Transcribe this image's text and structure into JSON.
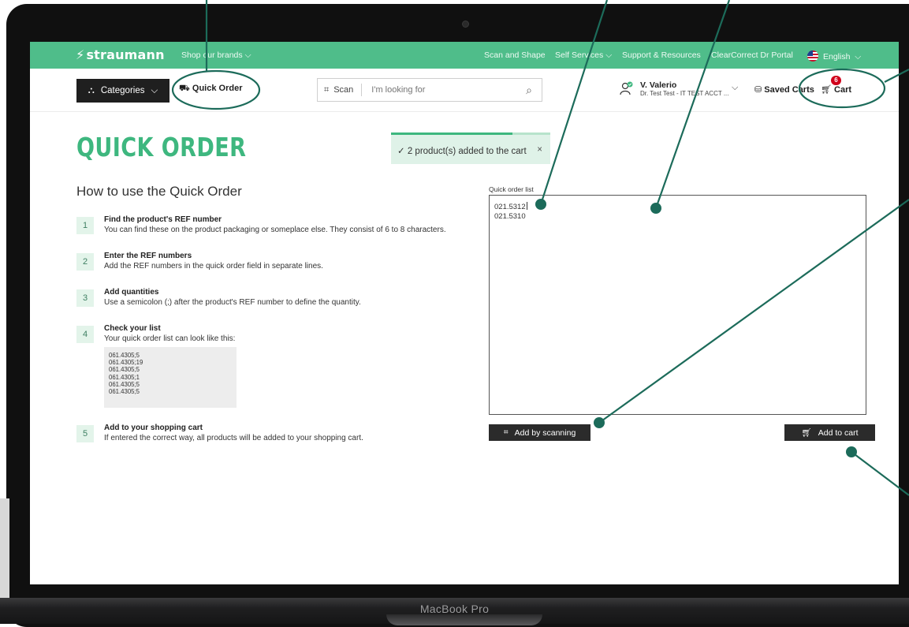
{
  "device": {
    "label": "MacBook Pro"
  },
  "topbar": {
    "brand": "straumann",
    "shop_brands": "Shop our brands",
    "scan_shape": "Scan and Shape",
    "self_services": "Self Services",
    "support": "Support & Resources",
    "clearcorrect": "ClearCorrect Dr Portal",
    "language": "English"
  },
  "header": {
    "categories": "Categories",
    "quick_order": "Quick Order",
    "scan": "Scan",
    "search_placeholder": "I'm looking for",
    "user_name": "V. Valerio",
    "user_account": "Dr. Test Test - IT TEST ACCT ...",
    "saved_carts": "Saved Carts",
    "cart": "Cart",
    "cart_count": "6"
  },
  "page": {
    "title": "QUICK ORDER",
    "toast": {
      "message": "2 product(s) added to the cart",
      "close": "×",
      "progress": 0.76
    },
    "howto_title": "How to use the Quick Order",
    "steps": [
      {
        "num": "1",
        "title": "Find the product's REF number",
        "desc": "You can find these on the product packaging or someplace else. They consist of 6 to 8 characters."
      },
      {
        "num": "2",
        "title": "Enter the REF numbers",
        "desc": "Add the REF numbers in the quick order field in separate lines."
      },
      {
        "num": "3",
        "title": "Add quantities",
        "desc": "Use a semicolon (;) after the product's REF number to define the quantity."
      },
      {
        "num": "4",
        "title": "Check your list",
        "desc": "Your quick order list can look like this:"
      },
      {
        "num": "5",
        "title": "Add to your shopping cart",
        "desc": "If entered the correct way, all products will be added to your shopping cart."
      }
    ],
    "example_lines": [
      "061.4305;5",
      "061.4305;19",
      "061.4305;5",
      "061.4305;1",
      "061.4305;5",
      "061.4305;5"
    ],
    "quick_list_label": "Quick order list",
    "quick_list_lines": [
      "021.5312",
      "021.5310"
    ],
    "add_scanning": "Add by scanning",
    "add_to_cart": "Add to cart"
  },
  "colors": {
    "brand_green": "#4fbd8a",
    "title_green": "#3eb77f",
    "annotation": "#1c6b5a",
    "badge_red": "#d0021b"
  }
}
